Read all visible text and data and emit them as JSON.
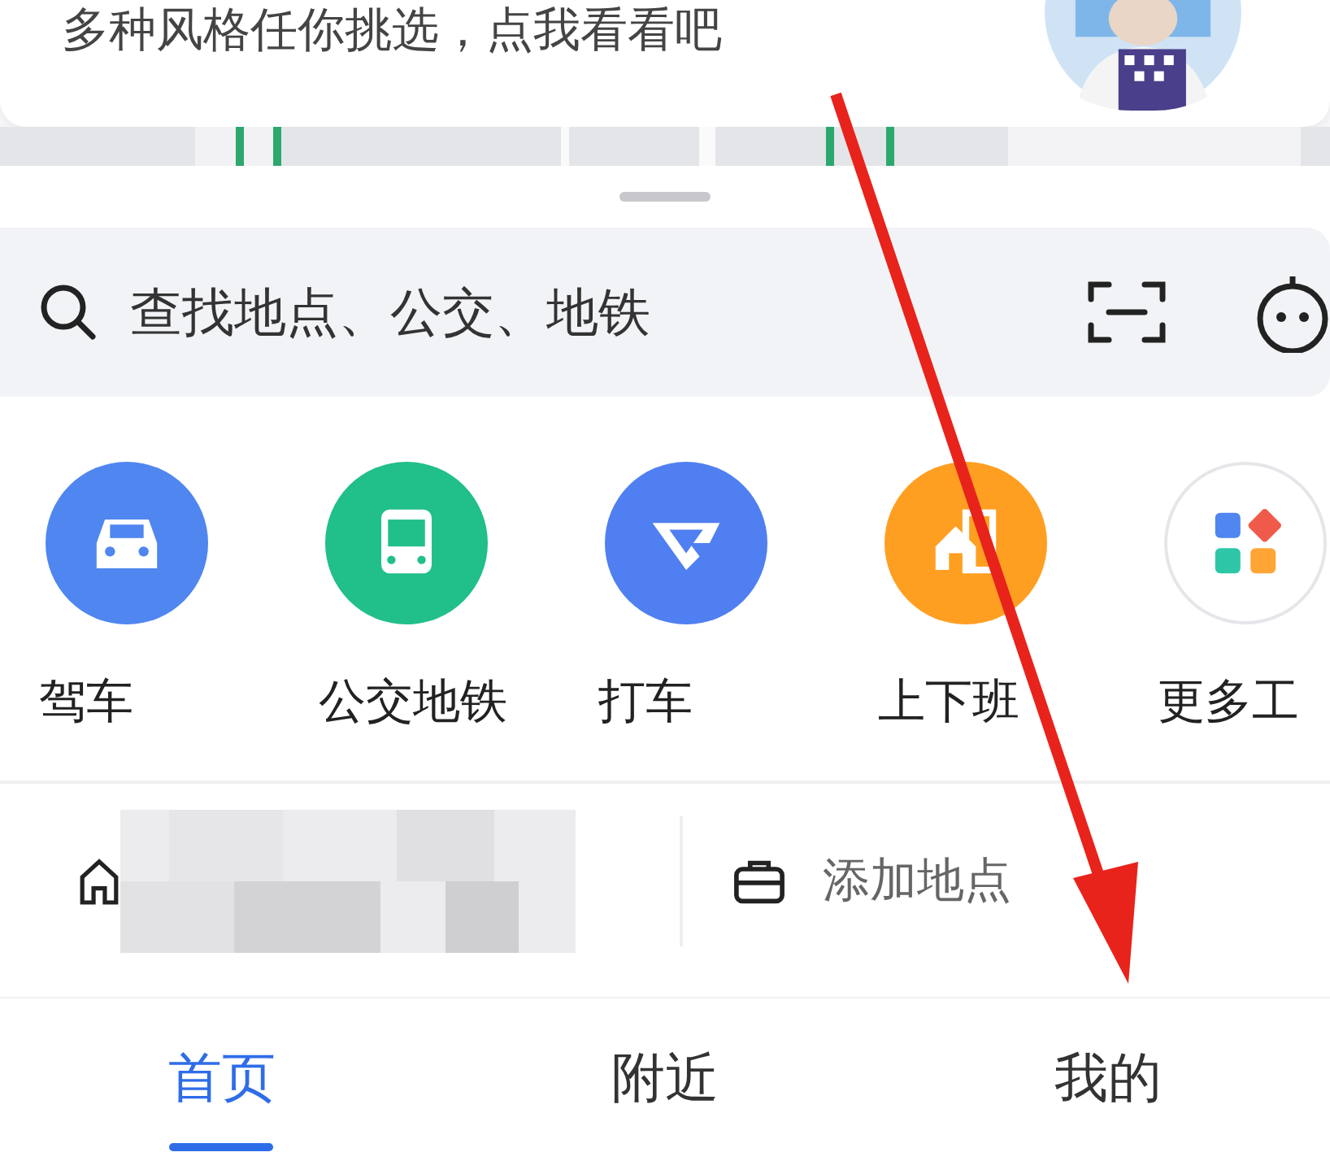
{
  "banner": {
    "text": "多种风格任你挑选，点我看看吧",
    "kind": "picture"
  },
  "search": {
    "placeholder": "查找地点、公交、地铁"
  },
  "tools": [
    {
      "label": "驾车",
      "kind": "car",
      "color": "#4f86f0"
    },
    {
      "label": "公交地铁",
      "kind": "bus",
      "color": "#21bf8a"
    },
    {
      "label": "打车",
      "kind": "taxi",
      "color": "#4f7ff0"
    },
    {
      "label": "上下班",
      "kind": "commute",
      "color": "#ff9f22"
    },
    {
      "label": "更多工",
      "kind": "more",
      "color": "#ffffff"
    }
  ],
  "places": [
    {
      "kind": "home"
    },
    {
      "kind": "work",
      "label": "添加地点"
    }
  ],
  "tabs": [
    {
      "label": "首页",
      "selected": true
    },
    {
      "label": "附近",
      "selected": false
    },
    {
      "label": "我的",
      "selected": false
    }
  ]
}
